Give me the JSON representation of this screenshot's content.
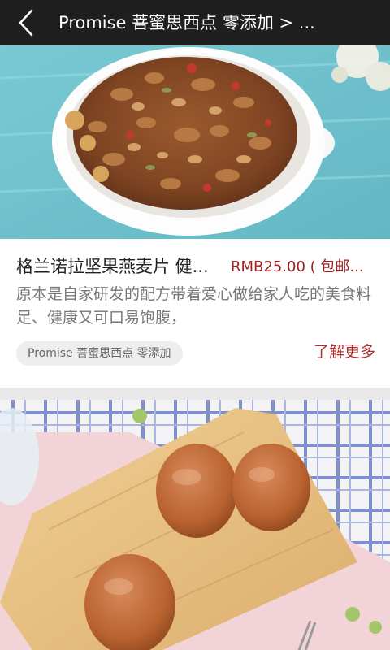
{
  "header": {
    "title": "Promise 菩蜜思西点 零添加 > ..."
  },
  "products": [
    {
      "title": "格兰诺拉坚果燕麦片 健...",
      "price": "RMB25.00 ( 包邮...",
      "description": "原本是自家研发的配方带着爱心做给家人吃的美食料足、健康又可口易饱腹，",
      "tag": "Promise 菩蜜思西点 零添加",
      "more_label": "了解更多"
    }
  ],
  "icons": {
    "back": "chevron-left-icon"
  },
  "colors": {
    "topbar_bg": "#1f1f1f",
    "price": "#a02020",
    "more_link": "#b03030"
  }
}
